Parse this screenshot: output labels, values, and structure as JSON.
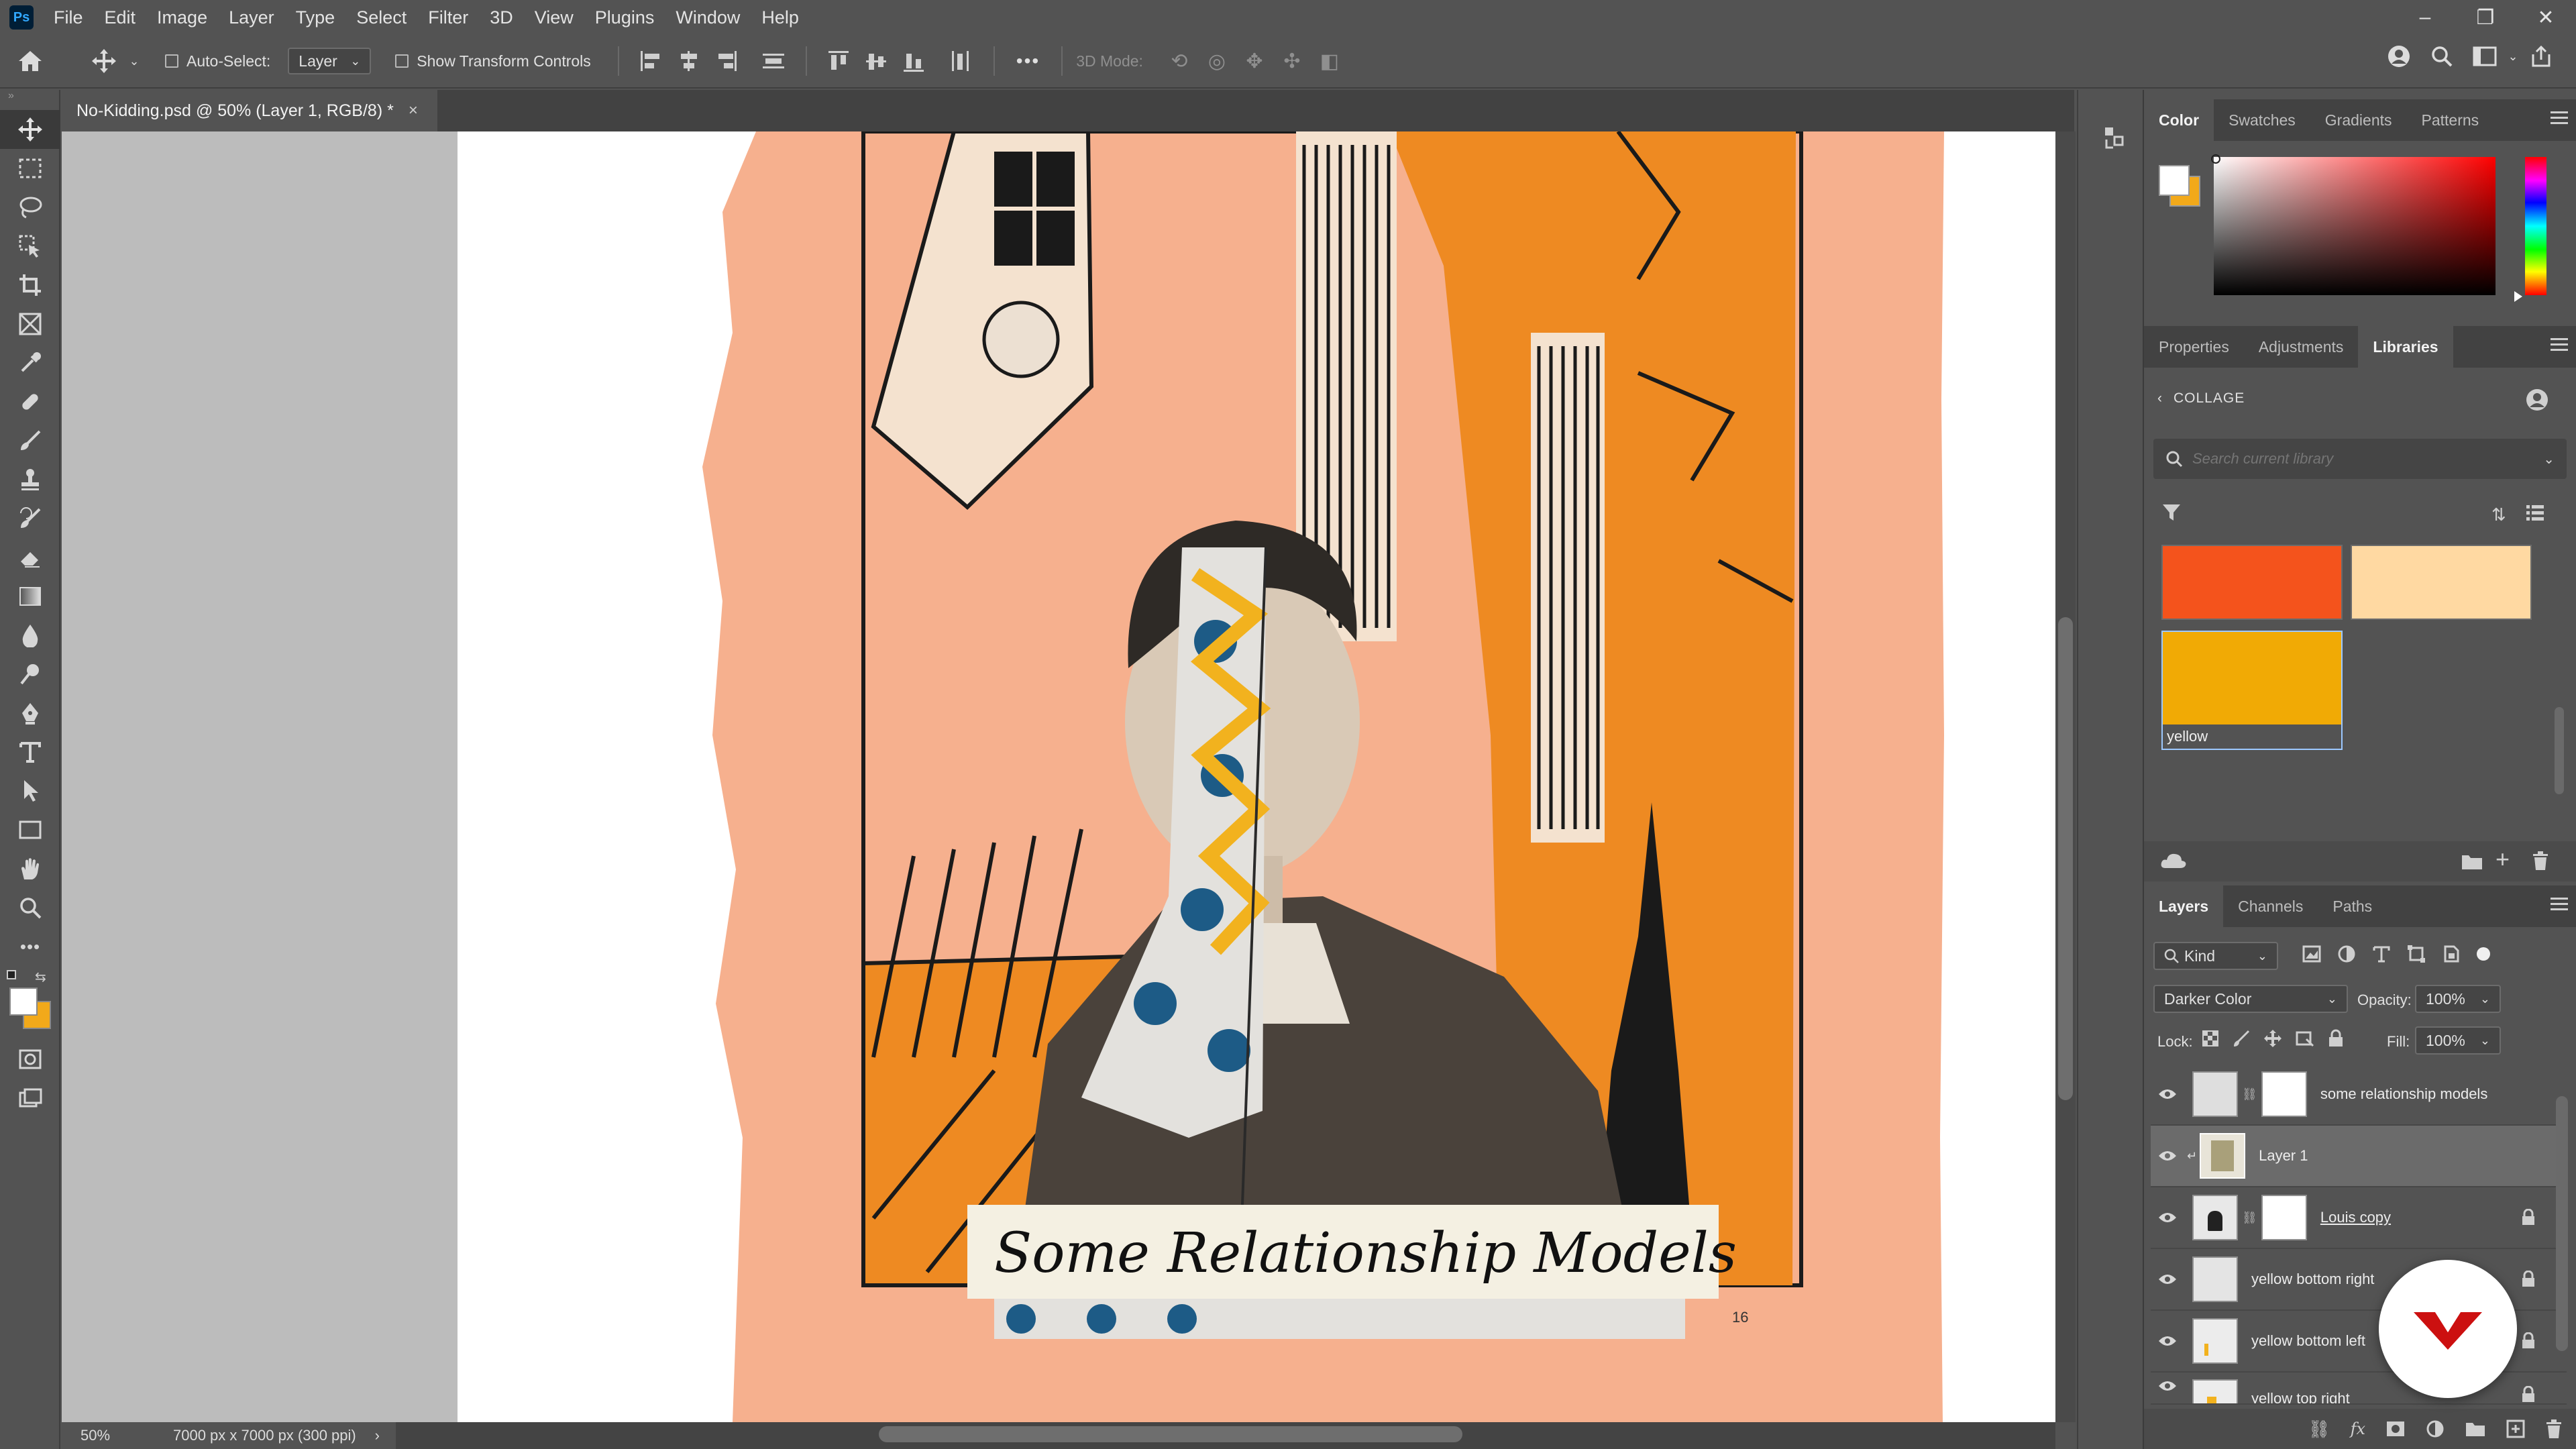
{
  "app": {
    "logo": "Ps"
  },
  "menubar": {
    "items": [
      "File",
      "Edit",
      "Image",
      "Layer",
      "Type",
      "Select",
      "Filter",
      "3D",
      "View",
      "Plugins",
      "Window",
      "Help"
    ]
  },
  "window_controls": {
    "minimize": "–",
    "restore": "❐",
    "close": "✕"
  },
  "optionsbar": {
    "auto_select_label": "Auto-Select:",
    "auto_select_checked": false,
    "layer_dropdown_value": "Layer",
    "show_transform_label": "Show Transform Controls",
    "show_transform_checked": false,
    "more_label": "•••",
    "mode_3d_label": "3D Mode:"
  },
  "document_tab": {
    "title": "No-Kidding.psd @ 50% (Layer 1, RGB/8) *",
    "close": "×"
  },
  "status": {
    "zoom": "50%",
    "dimensions": "7000 px x 7000 px (300 ppi)",
    "arrow": "›"
  },
  "artwork": {
    "caption": "Some Relationship Models",
    "page_number": "16",
    "colors": {
      "paper": "#f6b08e",
      "orange": "#ee8a22",
      "blue": "#1d5b86",
      "yellow": "#f2b21e"
    }
  },
  "color_panel": {
    "tabs": [
      "Color",
      "Swatches",
      "Gradients",
      "Patterns"
    ],
    "active_tab": "Color",
    "foreground": "#ffffff",
    "background": "#f2a91a"
  },
  "libraries_panel": {
    "tabs": [
      "Properties",
      "Adjustments",
      "Libraries"
    ],
    "active_tab": "Libraries",
    "library_name": "COLLAGE",
    "search_placeholder": "Search current library",
    "swatches": [
      {
        "color": "#f4531c",
        "label": ""
      },
      {
        "color": "#ffd9a2",
        "label": ""
      },
      {
        "color": "#f1aa05",
        "label": "yellow"
      }
    ]
  },
  "layers_panel": {
    "tabs": [
      "Layers",
      "Channels",
      "Paths"
    ],
    "active_tab": "Layers",
    "filter_kind": "Kind",
    "blend_mode": "Darker Color",
    "opacity_label": "Opacity:",
    "opacity_value": "100%",
    "lock_label": "Lock:",
    "fill_label": "Fill:",
    "fill_value": "100%",
    "layers": [
      {
        "name": "some relationship models",
        "visible": true,
        "locked": false,
        "selected": false,
        "has_mask": true
      },
      {
        "name": "Layer 1",
        "visible": true,
        "locked": false,
        "selected": true,
        "has_mask": false
      },
      {
        "name": "Louis copy",
        "visible": true,
        "locked": true,
        "selected": false,
        "has_mask": true
      },
      {
        "name": "yellow bottom right",
        "visible": true,
        "locked": true,
        "selected": false,
        "has_mask": false
      },
      {
        "name": "yellow bottom left",
        "visible": true,
        "locked": true,
        "selected": false,
        "has_mask": false
      },
      {
        "name": "yellow top right",
        "visible": true,
        "locked": true,
        "selected": false,
        "has_mask": false
      }
    ]
  },
  "accent_colors": {
    "brand_badge": "#cc1010"
  }
}
